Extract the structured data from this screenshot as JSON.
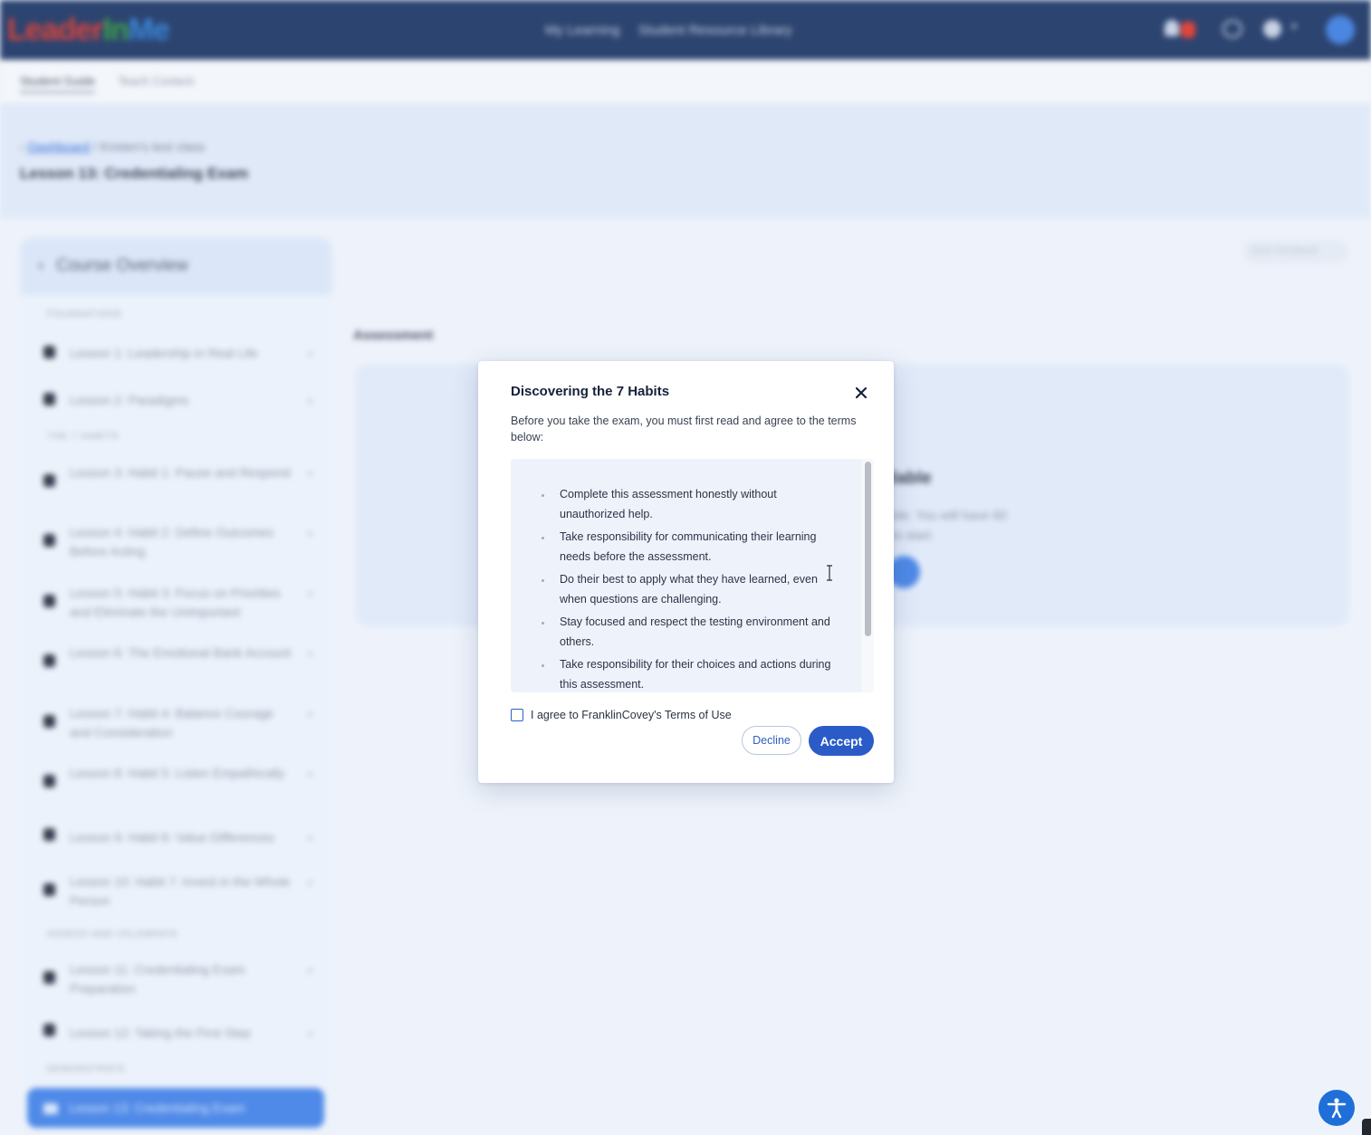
{
  "app": {
    "logo": {
      "part1": "Leader",
      "part2": "In",
      "part3": "Me"
    },
    "nav": [
      "My Learning",
      "Student Resource Library"
    ]
  },
  "subnav": {
    "tabs": [
      "Student Guide",
      "Teach Content"
    ]
  },
  "breadcrumb": {
    "link": "Dashboard",
    "separator": "/",
    "current": "Kristen's test class"
  },
  "page_title": "Lesson 13: Credentialing Exam",
  "sidebar": {
    "title": "Course Overview",
    "sections": {
      "foundations": "FOUNDATIONS",
      "habits": "THE 7 HABITS",
      "assess": "ASSESS AND CELEBRATE",
      "demonstrate": "DEMONSTRATE"
    },
    "lessons": [
      "Lesson 1: Leadership in Real Life",
      "Lesson 2: Paradigms",
      "Lesson 3: Habit 1: Pause and Respond",
      "Lesson 4: Habit 2: Define Outcomes Before Acting",
      "Lesson 5: Habit 3: Focus on Priorities and Eliminate the Unimportant",
      "Lesson 6: The Emotional Bank Account",
      "Lesson 7: Habit 4: Balance Courage and Consideration",
      "Lesson 8: Habit 5: Listen Empathically",
      "Lesson 9: Habit 6: Value Differences",
      "Lesson 10: Habit 7: Invest in the Whole Person",
      "Lesson 11: Credentialing Exam Preparation",
      "Lesson 12: Taking the First Step"
    ],
    "active_lesson": "Lesson 13: Credentialing Exam"
  },
  "main": {
    "section_label": "Assessment",
    "feedback_label": "Give Feedback",
    "available_title": "ilable",
    "available_text_1": "ble. You will have 60",
    "available_text_2": "to start."
  },
  "modal": {
    "title": "Discovering the 7 Habits",
    "intro": "Before you take the exam, you must first read and agree to the terms below:",
    "terms": [
      "Complete this assessment honestly without unauthorized help.",
      "Take responsibility for communicating their learning needs before the assessment.",
      "Do their best to apply what they have learned, even when questions are challenging.",
      "Stay focused and respect the testing environment and others.",
      "Take responsibility for their choices and actions during this assessment."
    ],
    "agree_label": "I agree to FranklinCovey's Terms of Use",
    "agree_checked": false,
    "decline_label": "Decline",
    "accept_label": "Accept"
  },
  "colors": {
    "topbar": "#2c4470",
    "accent": "#2a5bc7",
    "modal_bg": "#ffffff",
    "terms_bg": "#eef3fb"
  },
  "icons": [
    "close-icon",
    "accessibility-icon",
    "chevron-right-icon",
    "chevron-left-icon",
    "bell-icon",
    "heart-icon",
    "globe-icon"
  ]
}
